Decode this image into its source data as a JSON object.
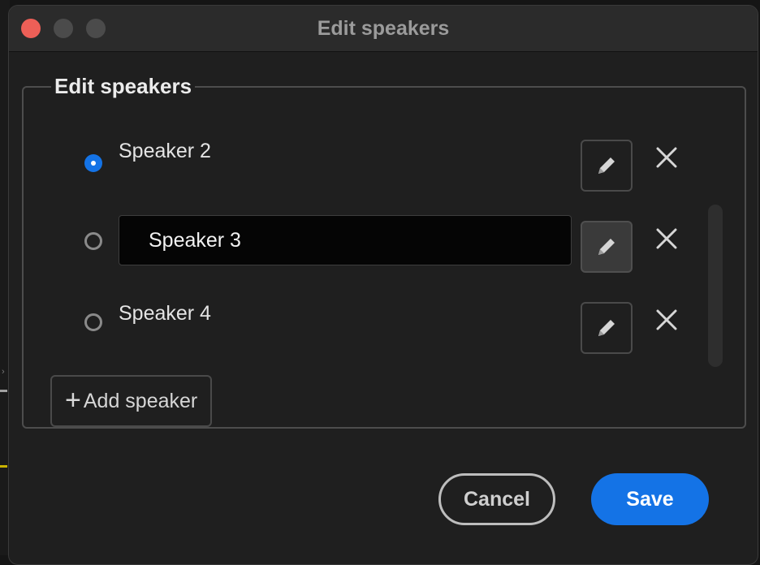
{
  "window": {
    "title": "Edit speakers"
  },
  "group": {
    "legend": "Edit speakers"
  },
  "speakers": [
    {
      "name": "Speaker 2",
      "selected": true,
      "editing": false
    },
    {
      "name": "Speaker 3",
      "selected": false,
      "editing": true
    },
    {
      "name": "Speaker 4",
      "selected": false,
      "editing": false
    }
  ],
  "icons": {
    "edit": "pencil-icon",
    "remove": "close-icon",
    "add": "plus-icon"
  },
  "actions": {
    "add_speaker": "Add speaker",
    "cancel": "Cancel",
    "save": "Save"
  },
  "colors": {
    "accent": "#1473e6",
    "close_traffic_light": "#ed5f57"
  }
}
